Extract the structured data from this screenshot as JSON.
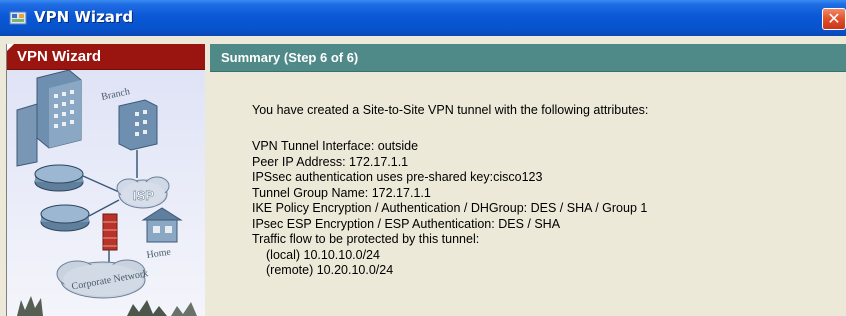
{
  "window": {
    "title": "VPN Wizard",
    "close_glyph": "✕"
  },
  "left_panel": {
    "header": "VPN Wizard",
    "illustration_labels": {
      "branch": "Branch",
      "isp": "ISP",
      "home": "Home",
      "corporate_network": "Corporate Network"
    }
  },
  "summary": {
    "header": "Summary  (Step 6 of 6)",
    "intro": "You have created a Site-to-Site VPN tunnel with the following attributes:",
    "attributes": [
      "VPN Tunnel Interface: outside",
      "Peer IP Address: 172.17.1.1",
      "IPSsec authentication uses pre-shared key:cisco123",
      "Tunnel Group Name: 172.17.1.1",
      "IKE Policy Encryption / Authentication / DHGroup: DES / SHA / Group 1",
      "IPsec ESP Encryption / ESP Authentication: DES / SHA",
      "Traffic flow to be protected by this tunnel:",
      "(local) 10.10.10.0/24",
      "(remote) 10.20.10.0/24"
    ]
  },
  "colors": {
    "titlebar": "#0a58d6",
    "left_header": "#9a1410",
    "right_header": "#4f8a88",
    "body_bg": "#ece9d8",
    "close_button": "#e0502a"
  }
}
